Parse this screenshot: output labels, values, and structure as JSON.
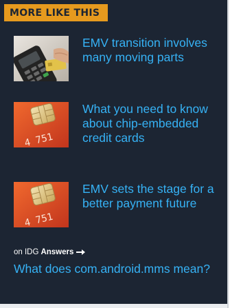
{
  "header": {
    "title": "MORE LIKE THIS"
  },
  "articles": [
    {
      "title": "EMV transition involves many moving parts",
      "thumb_icon": "card-reader-image"
    },
    {
      "title": "What you need to know about chip-embedded credit cards",
      "thumb_icon": "chip-card-image"
    },
    {
      "title": "EMV sets the stage for a better payment future",
      "thumb_icon": "chip-card-image"
    }
  ],
  "idg_answers": {
    "prefix": "on IDG",
    "brand": "Answers",
    "question": "What does com.android.mms mean?"
  },
  "colors": {
    "background": "#1c2533",
    "header": "#e69a1e",
    "link": "#36b2f5"
  }
}
